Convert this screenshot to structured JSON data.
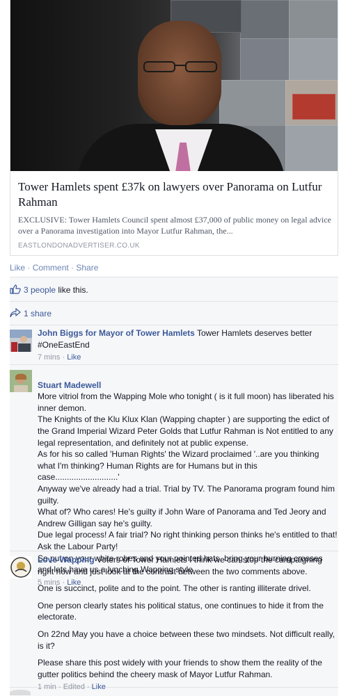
{
  "card": {
    "title": "Tower Hamlets spent £37k on lawyers over Panorama on Lutfur Rahman",
    "description": "EXCLUSIVE: Tower Hamlets Council spent almost £37,000 of public money on legal advice over a Panorama investigation into Mayor Lutfur Rahman, the...",
    "domain": "EASTLONDONADVERTISER.CO.UK"
  },
  "actions": {
    "like": "Like",
    "comment": "Comment",
    "share": "Share",
    "separator": " · "
  },
  "likes": {
    "count_text": "3 people",
    "suffix": " like this."
  },
  "shares": {
    "text": "1 share"
  },
  "comments": [
    {
      "author": "John Biggs for Mayor of Tower Hamlets",
      "text": "Tower Hamlets deserves better #OneEastEnd",
      "meta_time": "7 mins",
      "meta_like": "Like"
    },
    {
      "author": "Stuart Madewell",
      "text": "More vitriol from the Wapping Mole who tonight ( is it full moon) has liberated his inner demon.\nThe Knights of the Klu Klux Klan (Wapping chapter ) are supporting the edict of the Grand Imperial Wizard Peter Golds that Lutfur Rahman is Not entitled to any legal representation, and definitely not at public expense.\nAs for his so called 'Human Rights' the Wizard proclaimed '..are you thinking what I'm thinking? Human Rights are for Humans but in this case...........................'\nAnyway we've already had a trial. Trial by TV. The Panorama program found him guilty.\nWhat of? Who cares! He's guilty if John Ware of Panorama and Ted Jeory and Andrew Gilligan say he's guilty.\nDue legal process! A fair trial? No right thinking person thinks he's entitled to that! Ask the Labour Party!\nSo put on your white robes and your pointed hats, bring your burning crosses and lets have us a lynching Wapping style",
      "meta_time": "5 mins",
      "meta_like": "Like"
    },
    {
      "author": "Love Wapping",
      "paragraphs": [
        "Voters of Tower Hamlets I think we can stop the campaigning right now and just look at the contrast between the two comments above.",
        "One is succinct, polite and to the point. The other is ranting illiterate drivel.",
        "One person clearly states his political status, one continues to hide it from the electorate.",
        "On 22nd May you have a choice between these two mindsets. Not difficult really, is it?",
        "Please share this post widely with your friends to show them the reality of the gutter politics behind the cheery mask of Mayor Lutfur Rahman."
      ],
      "meta_time": "1 min",
      "meta_edited": "Edited",
      "meta_like": "Like"
    }
  ],
  "colors": {
    "link": "#3b5998",
    "meta": "#9197a3",
    "feedback_bg": "#f6f7f9",
    "action_link": "#6d84b4"
  },
  "icons": {
    "like": "thumbs-up-icon",
    "share": "share-arrow-icon"
  }
}
